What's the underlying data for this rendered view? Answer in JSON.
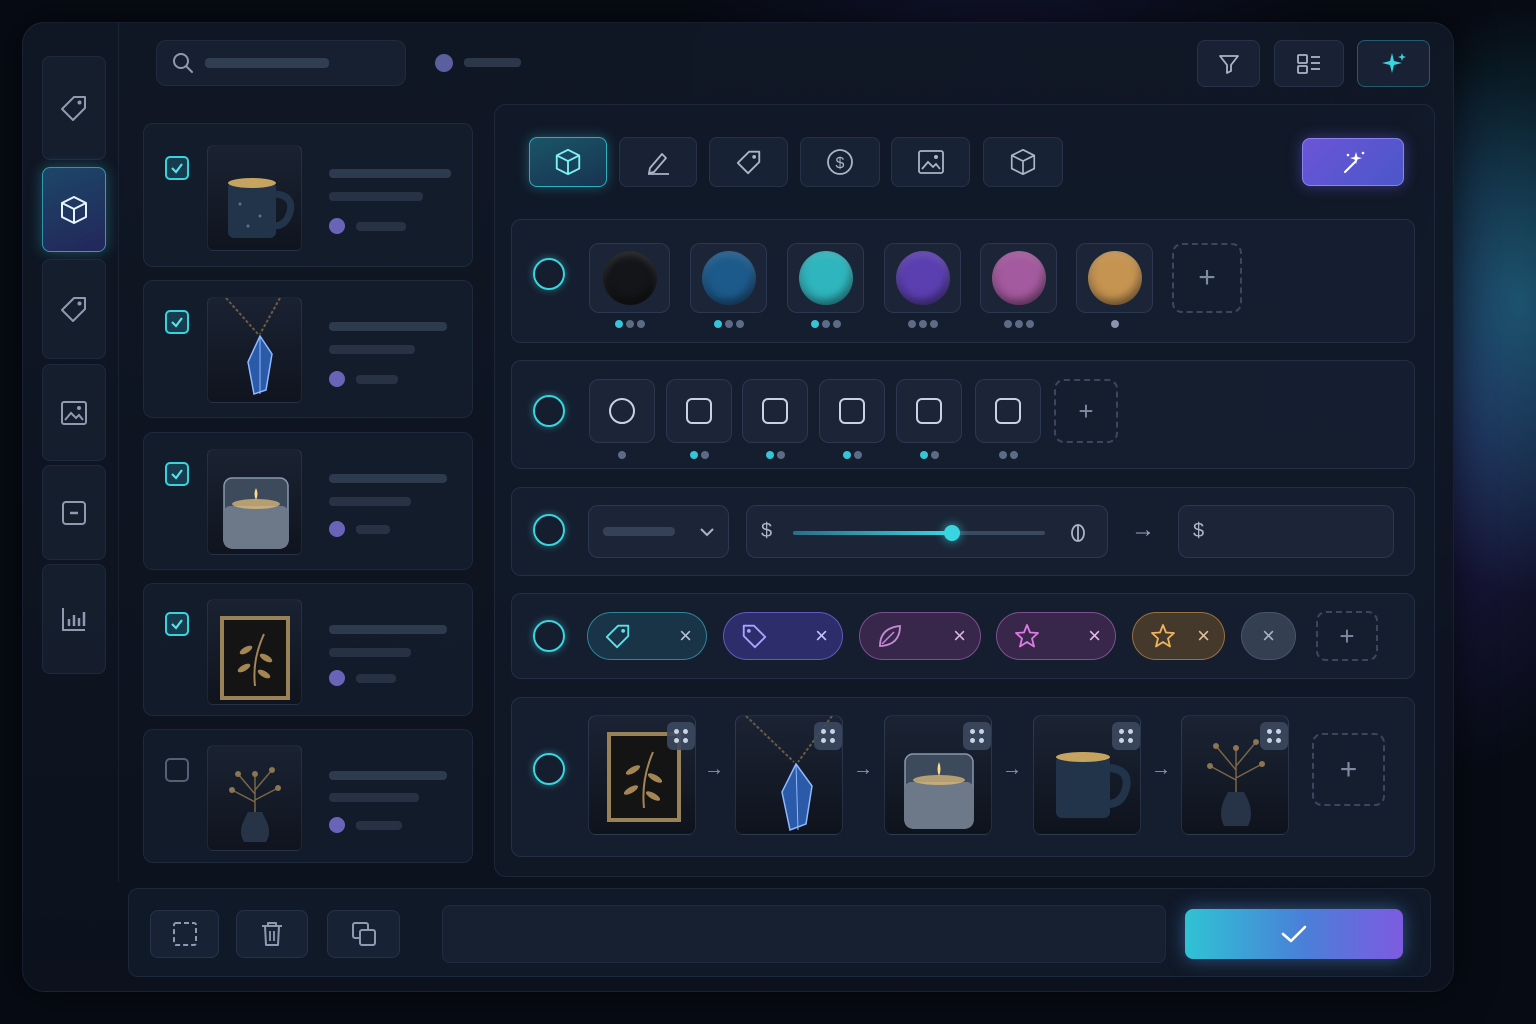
{
  "header": {
    "search": {
      "placeholder": ""
    },
    "actions": [
      {
        "id": "filter",
        "icon": "filter-icon"
      },
      {
        "id": "layout",
        "icon": "layout-grid-icon"
      },
      {
        "id": "ai",
        "icon": "sparkle-icon"
      }
    ]
  },
  "sidebar": {
    "items": [
      {
        "icon": "tag-icon",
        "active": false
      },
      {
        "icon": "cube-icon",
        "active": true
      },
      {
        "icon": "price-tag-icon",
        "active": false
      },
      {
        "icon": "image-icon",
        "active": false
      },
      {
        "icon": "minus-box-icon",
        "active": false
      },
      {
        "icon": "bar-chart-icon",
        "active": false
      }
    ]
  },
  "products": [
    {
      "name": "mug",
      "checked": true
    },
    {
      "name": "crystal-necklace",
      "checked": true
    },
    {
      "name": "candle",
      "checked": true
    },
    {
      "name": "framed-botanical",
      "checked": true
    },
    {
      "name": "vase-branch",
      "checked": false
    }
  ],
  "editor": {
    "tabs": [
      {
        "icon": "cube-icon",
        "active": true
      },
      {
        "icon": "pencil-icon",
        "active": false
      },
      {
        "icon": "tag-icon",
        "active": false
      },
      {
        "icon": "dollar-icon",
        "active": false
      },
      {
        "icon": "image-icon",
        "active": false
      },
      {
        "icon": "cube-outline-icon",
        "active": false
      }
    ],
    "magic_button_icon": "magic-wand-icon",
    "colors": {
      "swatches": [
        "#141518",
        "#1d5a8c",
        "#2fb5bd",
        "#5b3fb0",
        "#a45a9e",
        "#c69451"
      ],
      "variants": [
        3,
        3,
        3,
        3,
        3,
        1
      ],
      "add_label": "+"
    },
    "shapes": {
      "items": [
        "circle",
        "square",
        "square",
        "square",
        "square",
        "square"
      ],
      "variants": [
        1,
        2,
        2,
        2,
        2,
        2
      ],
      "add_label": "+"
    },
    "price": {
      "currency_symbol_from": "$",
      "currency_symbol_to": "$",
      "slider_value": 0.63,
      "arrow": "→"
    },
    "tags": [
      {
        "icon": "tag-icon",
        "color": "#3ad6df"
      },
      {
        "icon": "tag-icon",
        "color": "#7b78e8"
      },
      {
        "icon": "leaf-icon",
        "color": "#b67ec9"
      },
      {
        "icon": "star-icon",
        "color": "#d078d6"
      },
      {
        "icon": "star-icon",
        "color": "#e2a656"
      },
      {
        "icon": "close-icon",
        "color": "#9aa6bb"
      }
    ],
    "tags_add_label": "+",
    "sequence": [
      "framed-botanical",
      "crystal-necklace",
      "candle",
      "mug",
      "vase-branch"
    ],
    "sequence_arrow": "→",
    "sequence_add_label": "+"
  },
  "footer": {
    "actions": [
      "select-icon",
      "trash-icon",
      "duplicate-icon"
    ],
    "confirm_icon": "check-icon"
  }
}
